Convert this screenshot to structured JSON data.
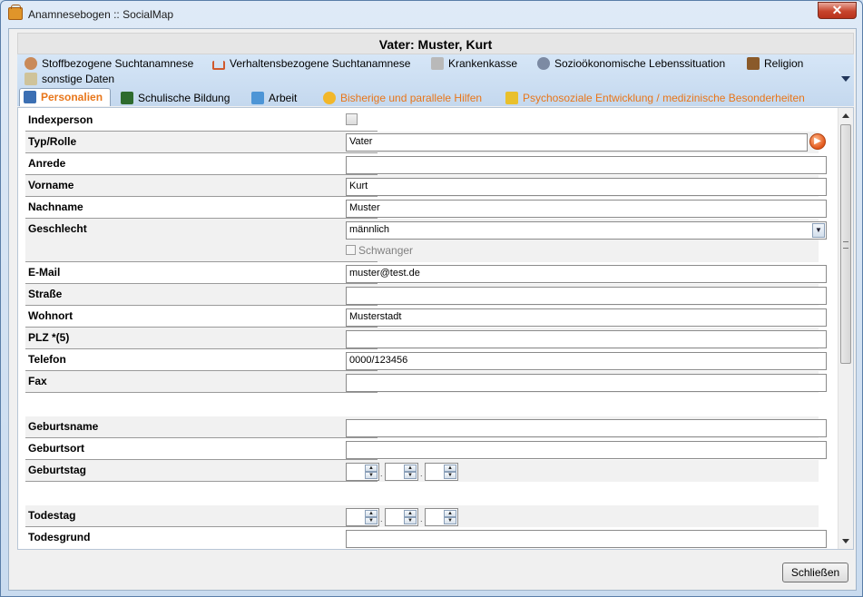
{
  "window": {
    "title": "Anamnesebogen :: SocialMap",
    "close_symbol": "✕"
  },
  "header": {
    "title": "Vater: Muster, Kurt"
  },
  "tabs": {
    "row1": [
      {
        "label": "Stoffbezogene Suchtanamnese",
        "icon": "skull-icon"
      },
      {
        "label": "Verhaltensbezogene Suchtanamnese",
        "icon": "cart-icon"
      },
      {
        "label": "Krankenkasse",
        "icon": "building-icon"
      },
      {
        "label": "Sozioökonomische Lebenssituation",
        "icon": "people-icon"
      },
      {
        "label": "Religion",
        "icon": "book-icon"
      },
      {
        "label": "sonstige Daten",
        "icon": "clipboard-icon"
      }
    ],
    "row2": [
      {
        "label": "Personalien",
        "icon": "id-card-icon",
        "active": true
      },
      {
        "label": "Schulische Bildung",
        "icon": "blackboard-icon"
      },
      {
        "label": "Arbeit",
        "icon": "work-icon"
      },
      {
        "label": "Bisherige und parallele Hilfen",
        "icon": "lifebuoy-icon"
      },
      {
        "label": "Psychosoziale Entwicklung / medizinische Besonderheiten",
        "icon": "puzzle-icon"
      }
    ]
  },
  "form": {
    "indexperson": {
      "label": "Indexperson",
      "checked": false
    },
    "typ_rolle": {
      "label": "Typ/Rolle",
      "value": "Vater"
    },
    "anrede": {
      "label": "Anrede",
      "value": ""
    },
    "vorname": {
      "label": "Vorname",
      "value": "Kurt"
    },
    "nachname": {
      "label": "Nachname",
      "value": "Muster"
    },
    "geschlecht": {
      "label": "Geschlecht",
      "value": "männlich"
    },
    "schwanger": {
      "label": "Schwanger",
      "checked": false
    },
    "email": {
      "label": "E-Mail",
      "value": "muster@test.de"
    },
    "strasse": {
      "label": "Straße",
      "value": ""
    },
    "wohnort": {
      "label": "Wohnort",
      "value": "Musterstadt"
    },
    "plz": {
      "label": "PLZ *(5)",
      "value": ""
    },
    "telefon": {
      "label": "Telefon",
      "value": "0000/123456"
    },
    "fax": {
      "label": "Fax",
      "value": ""
    },
    "geburtsname": {
      "label": "Geburtsname",
      "value": ""
    },
    "geburtsort": {
      "label": "Geburtsort",
      "value": ""
    },
    "geburtstag": {
      "label": "Geburtstag",
      "separator": "."
    },
    "todestag": {
      "label": "Todestag",
      "separator": "."
    },
    "todesgrund": {
      "label": "Todesgrund",
      "value": ""
    }
  },
  "footer": {
    "close_label": "Schließen"
  },
  "colors": {
    "accent_orange": "#e8761a",
    "title_gradient": "#c9dbef",
    "close_red": "#c7452d"
  }
}
